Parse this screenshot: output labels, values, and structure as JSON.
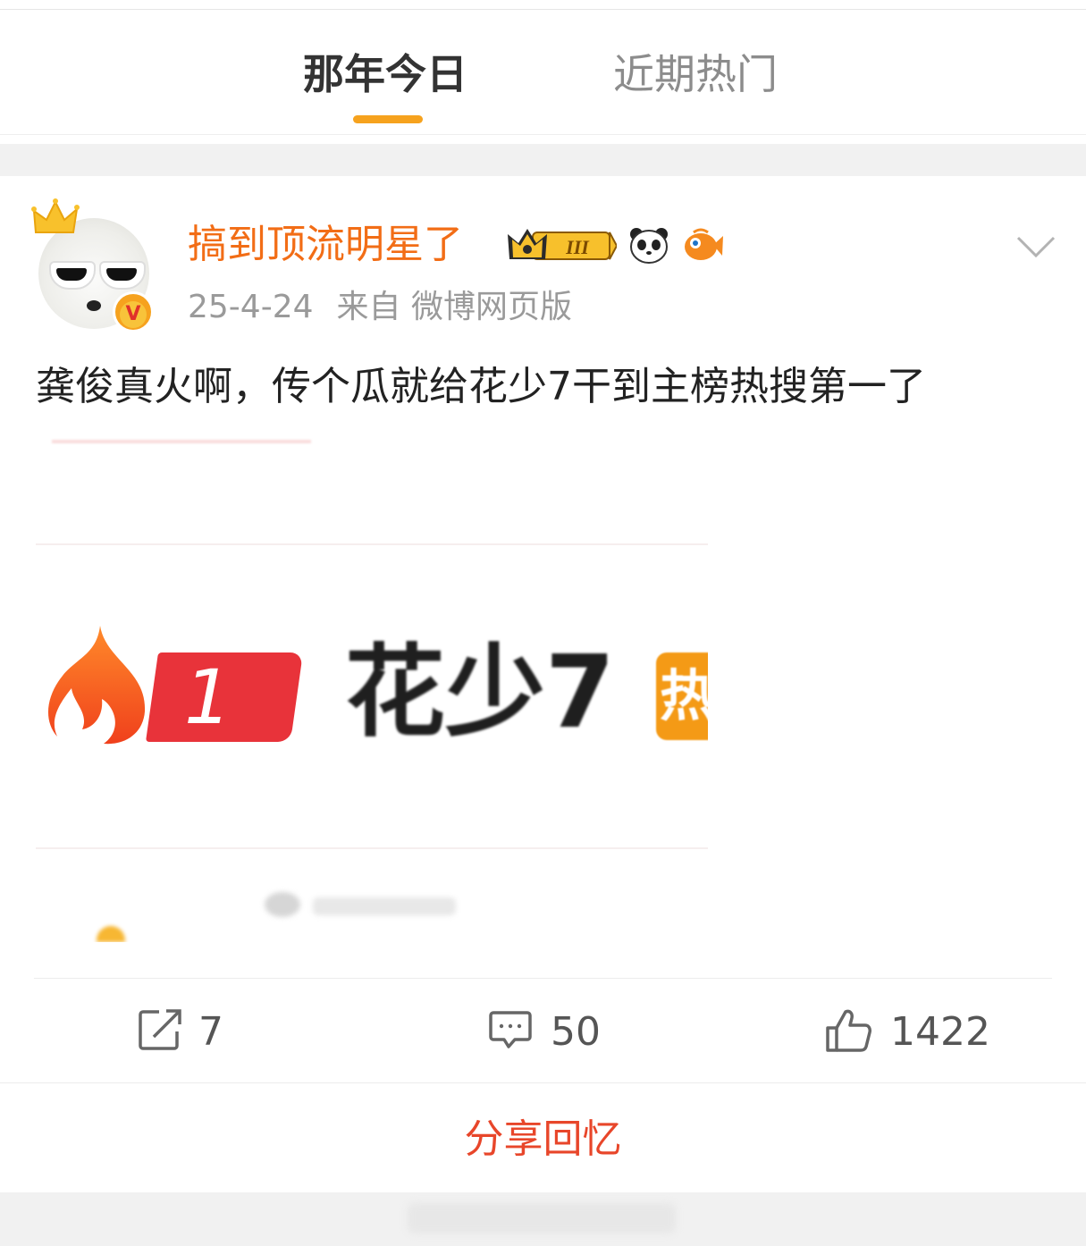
{
  "tabs": [
    {
      "label": "那年今日",
      "active": true
    },
    {
      "label": "近期热门",
      "active": false
    }
  ],
  "post": {
    "username": "搞到顶流明星了",
    "date": "25-4-24",
    "source": "来自 微博网页版",
    "text": "龚俊真火啊，传个瓜就给花少7干到主榜热搜第一了",
    "badges": [
      "crown-level-badge",
      "panda-badge",
      "fish-badge"
    ],
    "verified_icon": "V",
    "image": {
      "rank": "1",
      "title": "花少7",
      "tag": "热"
    }
  },
  "actions": {
    "repost_count": "7",
    "comment_count": "50",
    "like_count": "1422"
  },
  "share": {
    "label": "分享回忆"
  },
  "colors": {
    "accent": "#f6a21e",
    "username": "#f26d16",
    "share": "#e8462a",
    "rank_red": "#e8333a"
  }
}
